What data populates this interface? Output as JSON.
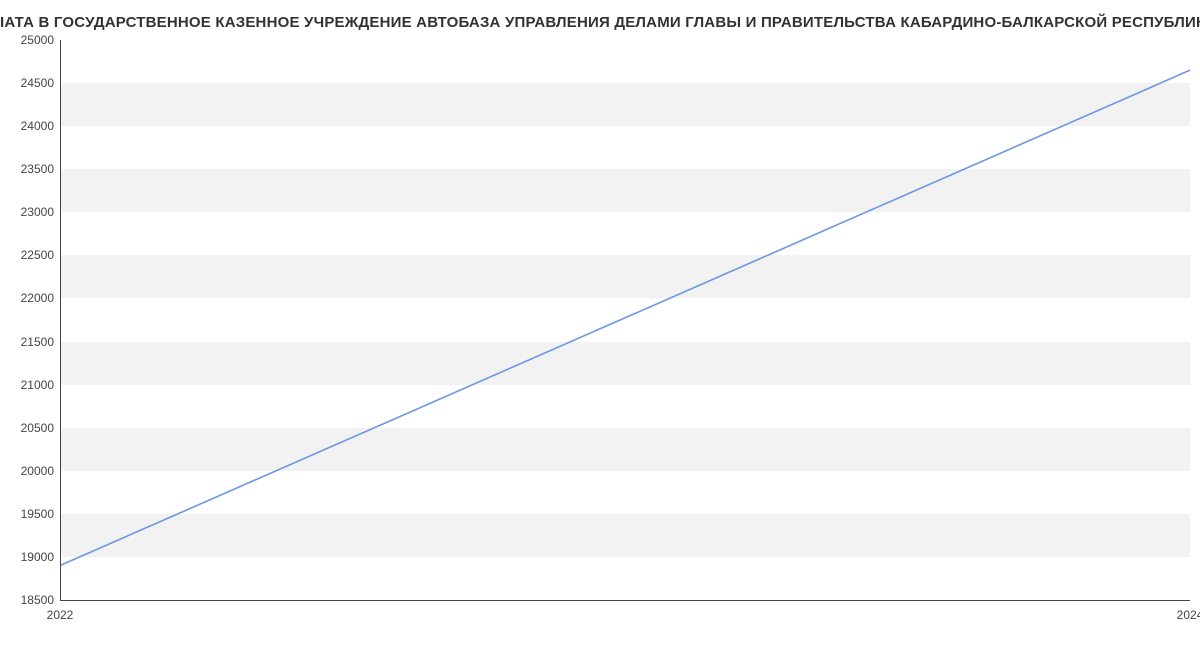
{
  "title": "IАТА В ГОСУДАРСТВЕННОЕ КАЗЕННОЕ УЧРЕЖДЕНИЕ АВТОБАЗА УПРАВЛЕНИЯ ДЕЛАМИ ГЛАВЫ И ПРАВИТЕЛЬСТВА КАБАРДИНО-БАЛКАРСКОЙ РЕСПУБЛИКИ | Данные mnogo",
  "chart_data": {
    "type": "line",
    "x": [
      2022,
      2024
    ],
    "y": [
      18900,
      24650
    ],
    "series_color": "#6f96e3",
    "xlabel": "",
    "ylabel": "",
    "x_ticks": [
      2022,
      2024
    ],
    "y_ticks": [
      18500,
      19000,
      19500,
      20000,
      20500,
      21000,
      21500,
      22000,
      22500,
      23000,
      23500,
      24000,
      24500,
      25000
    ],
    "xlim": [
      2022,
      2024
    ],
    "ylim": [
      18500,
      25000
    ]
  }
}
